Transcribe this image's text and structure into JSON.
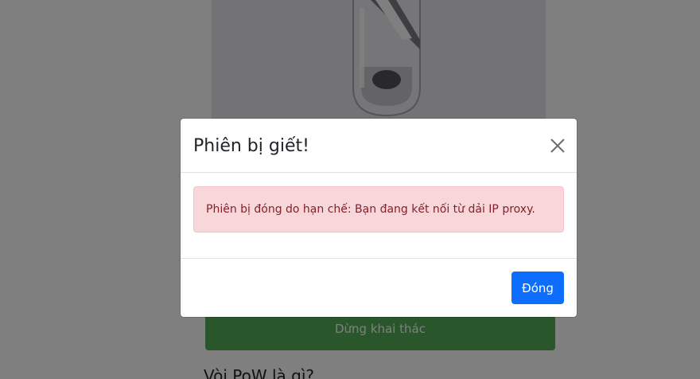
{
  "page": {
    "stop_button_label": "Dừng khai thác",
    "section_heading": "Vòi PoW là gì?",
    "hero_image_icon": "glass-tube-image"
  },
  "modal": {
    "title": "Phiên bị giết!",
    "close_icon": "close-icon",
    "alert_text": "Phiên bị đóng do hạn chế: Bạn đang kết nối từ dải IP proxy.",
    "footer_button_label": "Đóng"
  },
  "colors": {
    "backdrop": "#000000",
    "alert_background": "#f8d7da",
    "alert_text": "#842029",
    "primary_button": "#0d6efd",
    "stop_button": "#53ad57"
  }
}
